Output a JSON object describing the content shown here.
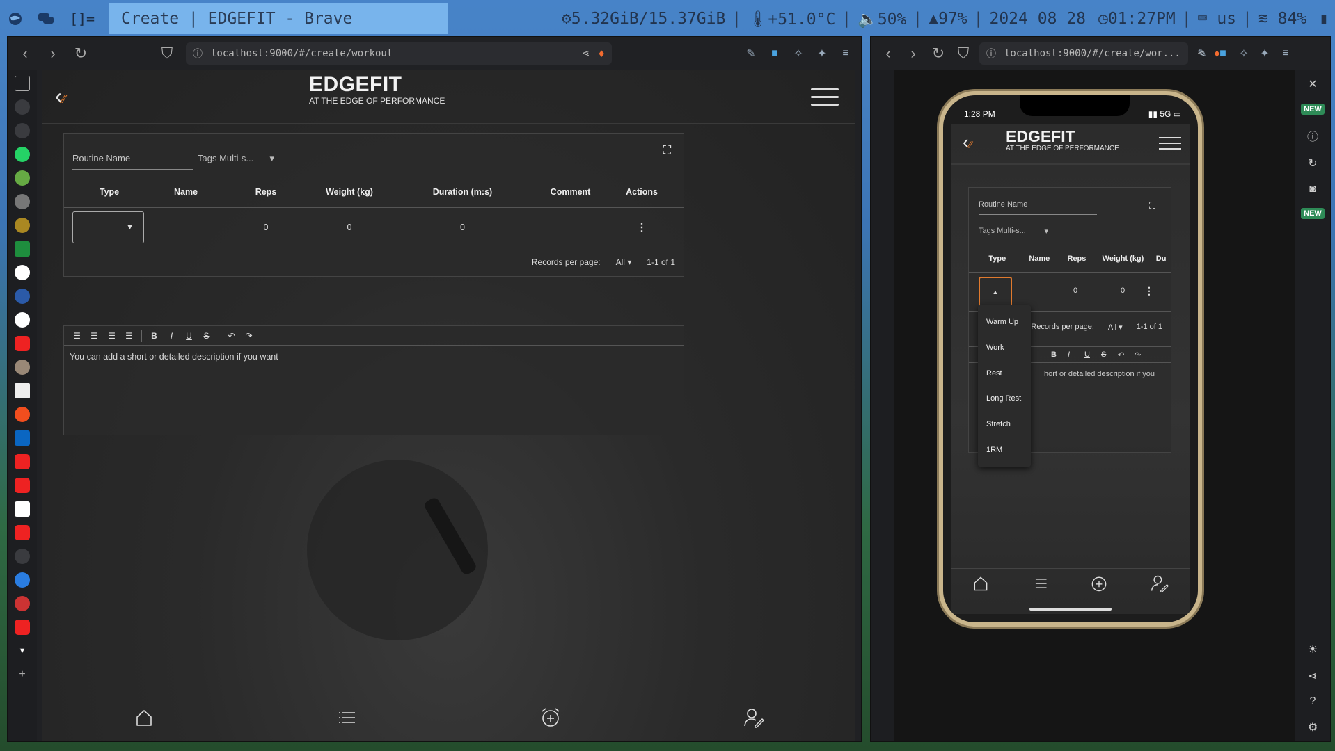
{
  "sysbar": {
    "title": "Create | EDGEFIT - Brave",
    "memory": "5.32GiB/15.37GiB",
    "temperature": "+51.0°C",
    "volume": "50%",
    "brightness": "97%",
    "date": "2024 08 28",
    "time": "01:27PM",
    "keyboard": "us",
    "wifi": "84%"
  },
  "left_browser": {
    "url": "localhost:9000/#/create/workout"
  },
  "right_browser": {
    "url": "localhost:9000/#/create/wor...",
    "badges": [
      "NEW",
      "NEW"
    ]
  },
  "app": {
    "brand_title": "EDGEFIT",
    "brand_tagline": "AT THE EDGE OF PERFORMANCE",
    "routine_placeholder": "Routine Name",
    "tags_label": "Tags Multi-s...",
    "columns": [
      "Type",
      "Name",
      "Reps",
      "Weight (kg)",
      "Duration (m:s)",
      "Comment",
      "Actions"
    ],
    "row": {
      "type": "",
      "name": "",
      "reps": "0",
      "weight": "0",
      "duration": "0",
      "comment": ""
    },
    "records_label": "Records per page:",
    "records_value": "All",
    "range": "1-1 of 1",
    "editor_placeholder": "You can add a short or detailed description if you want",
    "editor_tools": [
      "align-left",
      "align-center",
      "align-right",
      "justify",
      "bold",
      "italic",
      "underline",
      "strikethrough",
      "undo",
      "redo"
    ]
  },
  "phone": {
    "time": "1:28 PM",
    "network": "5G",
    "columns": [
      "Type",
      "Name",
      "Reps",
      "Weight (kg)",
      "Du"
    ],
    "row": {
      "reps": "0",
      "weight": "0"
    },
    "records_label": "Records per page:",
    "records_value": "All",
    "range": "1-1 of 1",
    "editor_text": "hort or detailed description if you",
    "type_options": [
      "Warm Up",
      "Work",
      "Rest",
      "Long Rest",
      "Stretch",
      "1RM"
    ]
  }
}
